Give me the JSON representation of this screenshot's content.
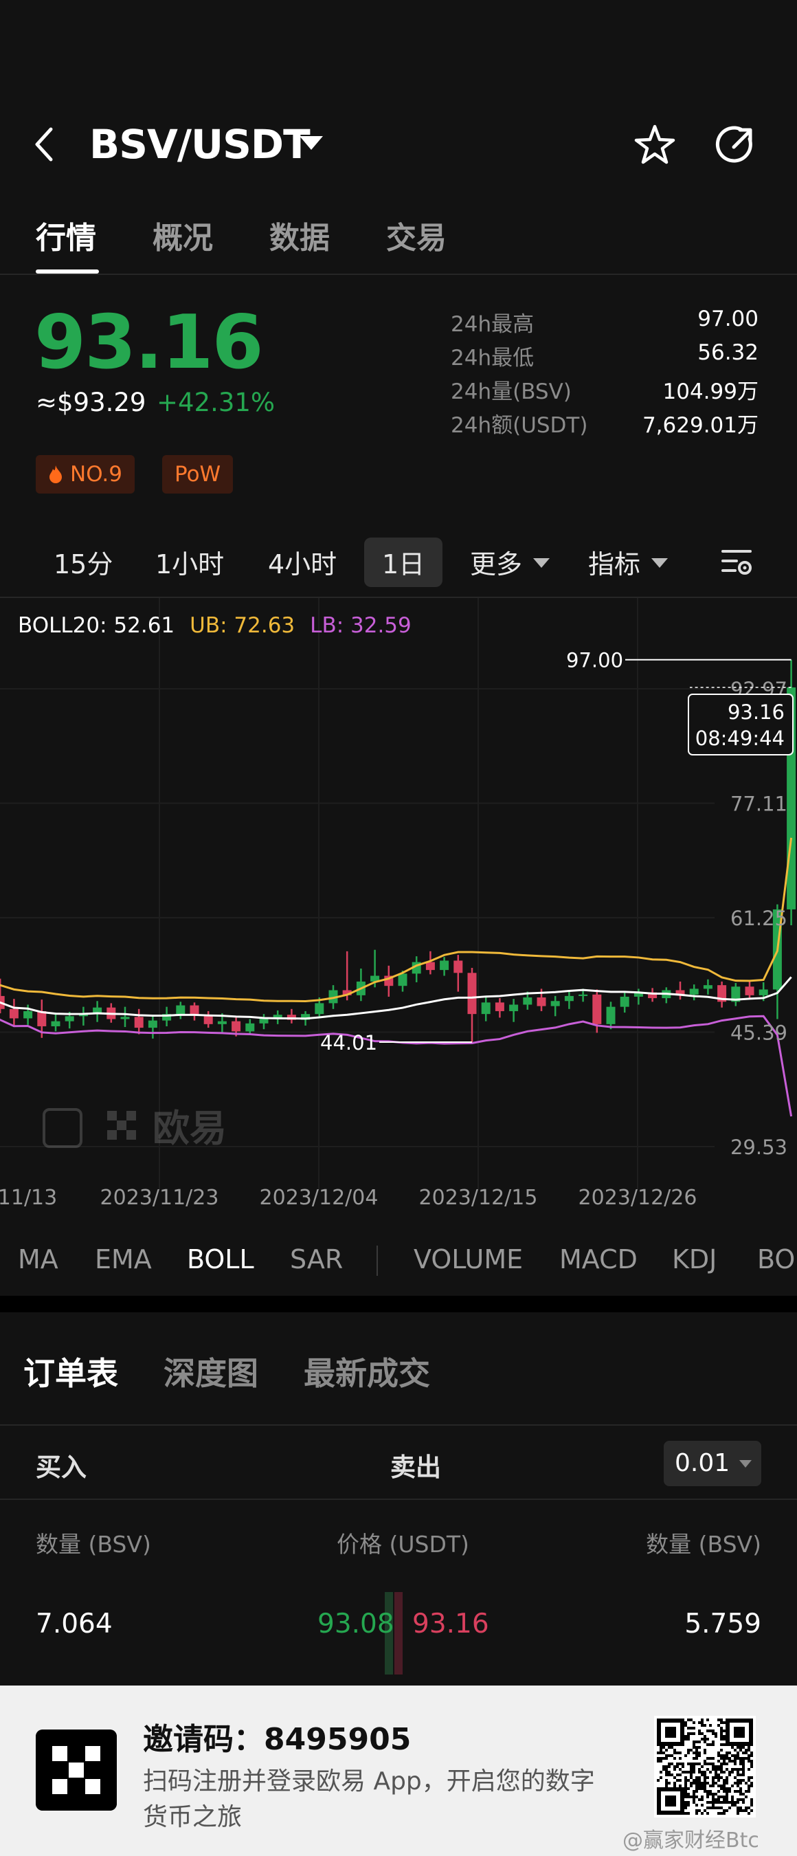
{
  "header": {
    "title": "BSV/USDT"
  },
  "tabs": [
    {
      "label": "行情"
    },
    {
      "label": "概况"
    },
    {
      "label": "数据"
    },
    {
      "label": "交易"
    }
  ],
  "ticker": {
    "price": "93.16",
    "price_usd": "≈$93.29",
    "change_pct": "+42.31%",
    "badges": [
      {
        "label": "NO.9",
        "icon": "flame-icon"
      },
      {
        "label": "PoW"
      }
    ],
    "stats": [
      {
        "label": "24h最高",
        "value": "97.00"
      },
      {
        "label": "24h最低",
        "value": "56.32"
      },
      {
        "label": "24h量(BSV)",
        "value": "104.99万"
      },
      {
        "label": "24h额(USDT)",
        "value": "7,629.01万"
      }
    ]
  },
  "timeframes": [
    "15分",
    "1小时",
    "4小时",
    "1日",
    "更多",
    "指标"
  ],
  "timeframe_active": "1日",
  "chart_legend": {
    "boll": "BOLL20: 52.61",
    "ub": "UB: 72.63",
    "lb": "LB: 32.59"
  },
  "chart_data": {
    "type": "candlestick",
    "y_ticks": [
      "92.97",
      "77.11",
      "61.25",
      "45.39",
      "29.53"
    ],
    "ylim": [
      29.53,
      92.97
    ],
    "x_ticks": [
      "11/13",
      "2023/11/23",
      "2023/12/04",
      "2023/12/15",
      "2023/12/26"
    ],
    "high_label": "97.00",
    "low_label": "44.01",
    "last_price": "93.16",
    "last_time": "08:49:44",
    "colors": {
      "up": "#25a750",
      "down": "#d9405e",
      "boll": "#ffffff",
      "ub": "#f0b93a",
      "lb": "#c85fd8"
    },
    "candles": [
      [
        50.5,
        51.5,
        48.6,
        50.4
      ],
      [
        50.4,
        52.8,
        48.0,
        48.6
      ],
      [
        48.6,
        50.0,
        46.1,
        47.3
      ],
      [
        47.3,
        49.2,
        46.4,
        48.3
      ],
      [
        48.3,
        49.9,
        44.6,
        46.2
      ],
      [
        46.2,
        48.1,
        45.5,
        46.9
      ],
      [
        46.9,
        48.2,
        45.9,
        47.6
      ],
      [
        47.6,
        48.9,
        46.3,
        48.0
      ],
      [
        48.0,
        49.7,
        46.8,
        48.8
      ],
      [
        48.8,
        49.4,
        46.7,
        47.2
      ],
      [
        47.2,
        48.9,
        46.1,
        47.5
      ],
      [
        47.5,
        48.6,
        45.1,
        46.0
      ],
      [
        46.0,
        47.8,
        44.5,
        47.0
      ],
      [
        47.0,
        48.9,
        46.2,
        47.9
      ],
      [
        47.9,
        49.6,
        47.2,
        49.1
      ],
      [
        49.1,
        49.5,
        47.0,
        47.7
      ],
      [
        47.7,
        48.3,
        46.0,
        46.5
      ],
      [
        46.5,
        48.0,
        45.3,
        46.9
      ],
      [
        46.9,
        47.4,
        44.8,
        45.5
      ],
      [
        45.5,
        47.2,
        45.0,
        46.6
      ],
      [
        46.6,
        47.9,
        45.8,
        47.3
      ],
      [
        47.3,
        48.4,
        46.5,
        47.8
      ],
      [
        47.8,
        48.6,
        46.6,
        47.1
      ],
      [
        47.1,
        48.3,
        46.3,
        47.9
      ],
      [
        47.9,
        50.2,
        47.5,
        49.4
      ],
      [
        49.4,
        51.9,
        48.6,
        51.2
      ],
      [
        51.2,
        56.6,
        49.8,
        50.5
      ],
      [
        50.5,
        54.2,
        49.7,
        52.4
      ],
      [
        52.4,
        56.8,
        51.6,
        53.2
      ],
      [
        53.2,
        54.6,
        50.3,
        51.8
      ],
      [
        51.8,
        53.9,
        51.0,
        53.5
      ],
      [
        53.5,
        55.9,
        52.3,
        55.1
      ],
      [
        55.1,
        56.6,
        53.4,
        54.0
      ],
      [
        54.0,
        55.8,
        53.2,
        55.3
      ],
      [
        55.3,
        56.1,
        51.0,
        53.6
      ],
      [
        53.6,
        54.3,
        44.0,
        47.9
      ],
      [
        47.9,
        50.2,
        46.9,
        49.5
      ],
      [
        49.5,
        50.1,
        47.4,
        48.3
      ],
      [
        48.3,
        50.0,
        46.8,
        49.2
      ],
      [
        49.2,
        51.0,
        48.5,
        50.2
      ],
      [
        50.2,
        51.4,
        48.3,
        49.0
      ],
      [
        49.0,
        50.4,
        47.6,
        49.7
      ],
      [
        49.7,
        51.0,
        48.6,
        50.4
      ],
      [
        50.4,
        51.4,
        49.6,
        50.6
      ],
      [
        50.6,
        51.3,
        45.3,
        46.5
      ],
      [
        46.5,
        49.6,
        45.8,
        48.9
      ],
      [
        48.9,
        51.0,
        48.1,
        50.3
      ],
      [
        50.3,
        51.4,
        49.2,
        50.9
      ],
      [
        50.9,
        51.5,
        49.6,
        50.1
      ],
      [
        50.1,
        51.6,
        49.4,
        51.2
      ],
      [
        51.2,
        52.4,
        49.9,
        50.6
      ],
      [
        50.6,
        52.0,
        49.8,
        51.4
      ],
      [
        51.4,
        52.7,
        50.6,
        51.9
      ],
      [
        51.9,
        52.4,
        48.8,
        49.6
      ],
      [
        49.6,
        52.2,
        49.0,
        51.7
      ],
      [
        51.7,
        52.6,
        50.0,
        50.5
      ],
      [
        50.5,
        52.3,
        49.7,
        51.3
      ],
      [
        51.3,
        63.1,
        47.2,
        62.4
      ],
      [
        62.4,
        97.0,
        60.2,
        93.16
      ]
    ]
  },
  "indicators": [
    "MA",
    "EMA",
    "BOLL",
    "SAR",
    "VOLUME",
    "MACD",
    "KDJ",
    "BO"
  ],
  "indicator_active": "BOLL",
  "orderbook": {
    "tabs": [
      "订单表",
      "深度图",
      "最新成交"
    ],
    "buy_label": "买入",
    "sell_label": "卖出",
    "precision": "0.01",
    "headers": {
      "bid_qty": "数量 (BSV)",
      "price": "价格 (USDT)",
      "ask_qty": "数量 (BSV)"
    },
    "row": {
      "bid_qty": "7.064",
      "bid_price": "93.08",
      "ask_price": "93.16",
      "ask_qty": "5.759"
    }
  },
  "promo": {
    "title": "邀请码：8495905",
    "desc": "扫码注册并登录欧易 App，开启您的数字货币之旅",
    "watermark": "@赢家财经Btc"
  },
  "brand_watermark": "欧易"
}
